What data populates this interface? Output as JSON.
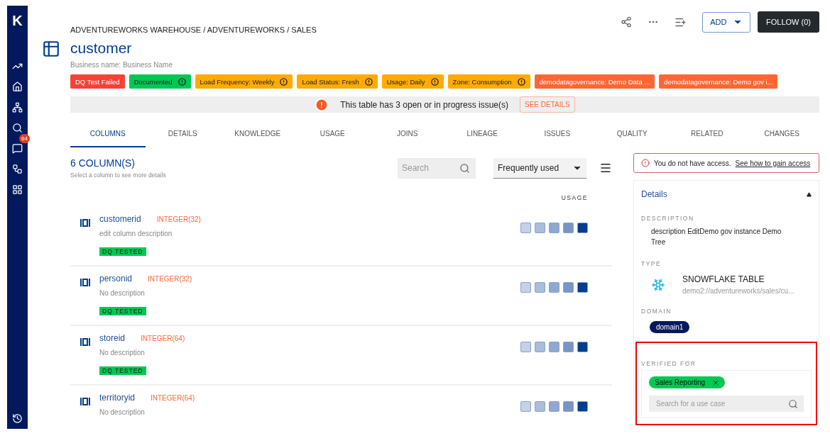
{
  "sidebar": {
    "logo": "K",
    "items": [
      {
        "kind": "trend"
      },
      {
        "kind": "home"
      },
      {
        "kind": "network"
      },
      {
        "kind": "search"
      },
      {
        "kind": "chat",
        "badge": "64"
      },
      {
        "kind": "tree"
      },
      {
        "kind": "widgets"
      }
    ],
    "bottom": {
      "kind": "history"
    }
  },
  "header": {
    "breadcrumb": "ADVENTUREWORKS WAREHOUSE / ADVENTUREWORKS / SALES",
    "title": "customer",
    "business_name": "Business name: Business Name",
    "add_button": "ADD",
    "follow_button": "FOLLOW (0)"
  },
  "tags": [
    {
      "label": "DQ Test Failed",
      "color": "#f44336",
      "icon": false
    },
    {
      "label": "Documented",
      "color": "#00c853",
      "icon": true
    },
    {
      "label": "Load Frequency: Weekly",
      "color": "#ffab00",
      "icon": true
    },
    {
      "label": "Load Status: Fresh",
      "color": "#ffab00",
      "icon": true
    },
    {
      "label": "Usage: Daily",
      "color": "#ffab00",
      "icon": true
    },
    {
      "label": "Zone: Consumption",
      "color": "#ffab00",
      "icon": true
    },
    {
      "label": "demodatagovernance: Demo Data ...",
      "color": "#ff6633",
      "icon": false
    },
    {
      "label": "demodatagovernance: Demo gov i...",
      "color": "#ff6633",
      "icon": false
    }
  ],
  "issue_banner": {
    "message": "This table has 3 open or in progress issue(s)",
    "button": "SEE DETAILS"
  },
  "tabs": [
    {
      "label": "COLUMNS",
      "selected": true
    },
    {
      "label": "DETAILS",
      "selected": false
    },
    {
      "label": "KNOWLEDGE",
      "selected": false
    },
    {
      "label": "USAGE",
      "selected": false
    },
    {
      "label": "JOINS",
      "selected": false
    },
    {
      "label": "LINEAGE",
      "selected": false
    },
    {
      "label": "ISSUES",
      "selected": false
    },
    {
      "label": "QUALITY",
      "selected": false
    },
    {
      "label": "RELATED",
      "selected": false
    },
    {
      "label": "CHANGES",
      "selected": false
    }
  ],
  "columns_panel": {
    "count": "6 COLUMN(S)",
    "hint": "Select a column to see more details",
    "search_placeholder": "Search",
    "sort": "Frequently used",
    "usage_heading": "USAGE",
    "rows": [
      {
        "name": "customerid",
        "type": "INTEGER(32)",
        "description": "edit column description",
        "badge": "DQ TESTED"
      },
      {
        "name": "personid",
        "type": "INTEGER(32)",
        "description": "No description",
        "badge": "DQ TESTED"
      },
      {
        "name": "storeid",
        "type": "INTEGER(64)",
        "description": "No description",
        "badge": "DQ TESTED"
      },
      {
        "name": "territoryid",
        "type": "INTEGER(64)",
        "description": "No description"
      }
    ]
  },
  "access_notice": {
    "message": "You do not have access.",
    "link": "See how to gain access"
  },
  "details": {
    "title": "Details",
    "expanded": true,
    "description_label": "DESCRIPTION",
    "description": "description EditDemo gov instance Demo Tree",
    "type_label": "TYPE",
    "type": "SNOWFLAKE TABLE",
    "path": "demo2://adventureworks/sales/cu...",
    "domain_label": "DOMAIN",
    "domain": "domain1",
    "verified": {
      "label": "VERIFIED FOR",
      "highlighted": true,
      "chips": [
        "Sales Reporting"
      ],
      "placeholder": "Search for a use case"
    }
  }
}
